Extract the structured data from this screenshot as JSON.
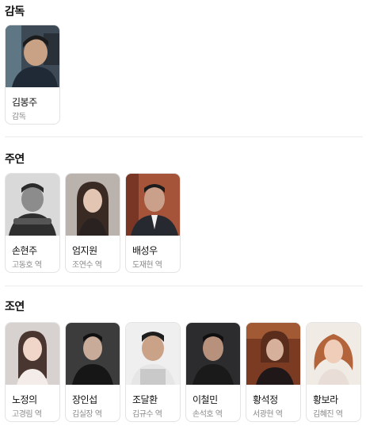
{
  "sections": {
    "director": {
      "title": "감독",
      "people": [
        {
          "name": "김봉주",
          "role": "감독",
          "photo": "director-photo"
        }
      ]
    },
    "lead": {
      "title": "주연",
      "people": [
        {
          "name": "손현주",
          "role": "고동호 역",
          "photo": "actor-photo"
        },
        {
          "name": "엄지원",
          "role": "조연수 역",
          "photo": "actress-photo"
        },
        {
          "name": "배성우",
          "role": "도재현 역",
          "photo": "actor-photo"
        }
      ]
    },
    "supporting": {
      "title": "조연",
      "people": [
        {
          "name": "노정의",
          "role": "고경림 역",
          "photo": "actress-photo"
        },
        {
          "name": "장인섭",
          "role": "김실장 역",
          "photo": "actor-photo"
        },
        {
          "name": "조달환",
          "role": "김규수 역",
          "photo": "actor-photo"
        },
        {
          "name": "이철민",
          "role": "손석호 역",
          "photo": "actor-photo"
        },
        {
          "name": "황석정",
          "role": "서광현 역",
          "photo": "actress-photo"
        },
        {
          "name": "황보라",
          "role": "김혜진 역",
          "photo": "actress-photo"
        }
      ]
    }
  },
  "colors": {
    "card_border": "#e3e3e3",
    "role_text": "#8a8a8a",
    "divider": "#ececec"
  }
}
